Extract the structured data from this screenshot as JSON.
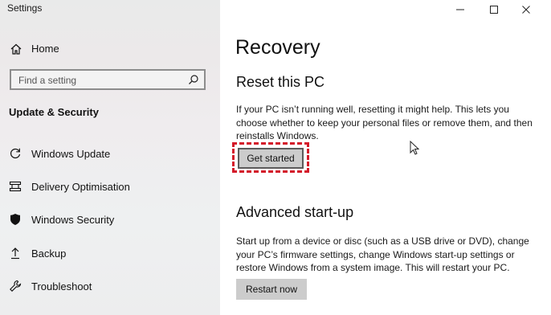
{
  "window": {
    "title": "Settings"
  },
  "sidebar": {
    "home_label": "Home",
    "search_placeholder": "Find a setting",
    "section_heading": "Update & Security",
    "items": [
      {
        "label": "Windows Update",
        "icon": "refresh-icon"
      },
      {
        "label": "Delivery Optimisation",
        "icon": "delivery-optimisation-icon"
      },
      {
        "label": "Windows Security",
        "icon": "shield-icon"
      },
      {
        "label": "Backup",
        "icon": "backup-arrow-icon"
      },
      {
        "label": "Troubleshoot",
        "icon": "wrench-icon"
      }
    ]
  },
  "main": {
    "page_title": "Recovery",
    "reset": {
      "heading": "Reset this PC",
      "description": "If your PC isn’t running well, resetting it might help. This lets you choose whether to keep your personal files or remove them, and then reinstalls Windows.",
      "button": "Get started"
    },
    "advanced": {
      "heading": "Advanced start-up",
      "description": "Start up from a device or disc (such as a USB drive or DVD), change your PC’s firmware settings, change Windows start-up settings or restore Windows from a system image. This will restart your PC.",
      "button": "Restart now"
    }
  },
  "colors": {
    "highlight": "#d41a2a",
    "sidebar_bg": "#ececec",
    "button_bg": "#cccccc"
  }
}
